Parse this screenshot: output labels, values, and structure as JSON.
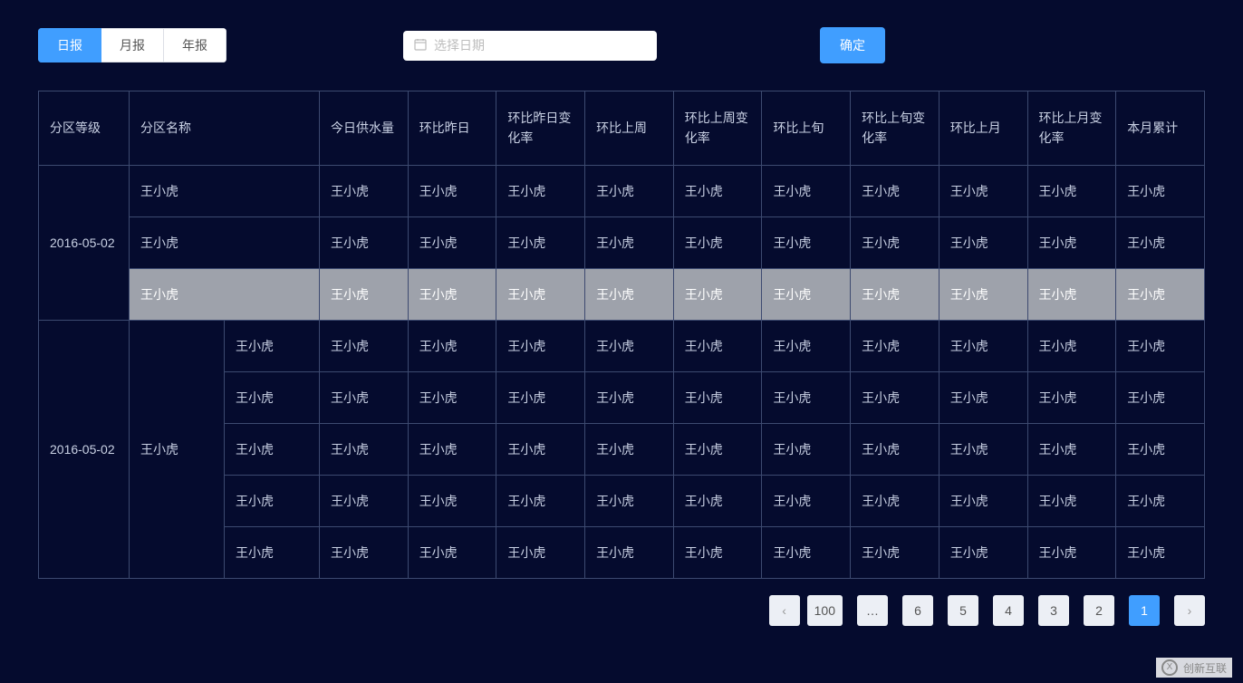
{
  "tabs": {
    "daily": "日报",
    "monthly": "月报",
    "yearly": "年报",
    "active": "daily"
  },
  "date_picker": {
    "placeholder": "选择日期"
  },
  "confirm_label": "确定",
  "table": {
    "headers": {
      "level": "分区等级",
      "name": "分区名称",
      "today_supply": "今日供水量",
      "vs_yesterday": "环比昨日",
      "vs_yesterday_rate": "环比昨日变化率",
      "vs_lastweek": "环比上周",
      "vs_lastweek_rate": "环比上周变化率",
      "vs_lastperiod": "环比上旬",
      "vs_lastperiod_rate": "环比上旬变化率",
      "vs_lastmonth": "环比上月",
      "vs_lastmonth_rate": "环比上月变化率",
      "month_total": "本月累计"
    },
    "groups": [
      {
        "level": "2016-05-02",
        "rows": [
          {
            "name": "王小虎",
            "cells": [
              "王小虎",
              "王小虎",
              "王小虎",
              "王小虎",
              "王小虎",
              "王小虎",
              "王小虎",
              "王小虎",
              "王小虎",
              "王小虎"
            ],
            "hover": false
          },
          {
            "name": "王小虎",
            "cells": [
              "王小虎",
              "王小虎",
              "王小虎",
              "王小虎",
              "王小虎",
              "王小虎",
              "王小虎",
              "王小虎",
              "王小虎",
              "王小虎"
            ],
            "hover": false
          },
          {
            "name": "王小虎",
            "cells": [
              "王小虎",
              "王小虎",
              "王小虎",
              "王小虎",
              "王小虎",
              "王小虎",
              "王小虎",
              "王小虎",
              "王小虎",
              "王小虎"
            ],
            "hover": true
          }
        ]
      },
      {
        "level": "2016-05-02",
        "sub_name": "王小虎",
        "rows": [
          {
            "cells": [
              "王小虎",
              "王小虎",
              "王小虎",
              "王小虎",
              "王小虎",
              "王小虎",
              "王小虎",
              "王小虎",
              "王小虎",
              "王小虎",
              "王小虎"
            ]
          },
          {
            "cells": [
              "王小虎",
              "王小虎",
              "王小虎",
              "王小虎",
              "王小虎",
              "王小虎",
              "王小虎",
              "王小虎",
              "王小虎",
              "王小虎",
              "王小虎"
            ]
          },
          {
            "cells": [
              "王小虎",
              "王小虎",
              "王小虎",
              "王小虎",
              "王小虎",
              "王小虎",
              "王小虎",
              "王小虎",
              "王小虎",
              "王小虎",
              "王小虎"
            ]
          },
          {
            "cells": [
              "王小虎",
              "王小虎",
              "王小虎",
              "王小虎",
              "王小虎",
              "王小虎",
              "王小虎",
              "王小虎",
              "王小虎",
              "王小虎",
              "王小虎"
            ]
          },
          {
            "cells": [
              "王小虎",
              "王小虎",
              "王小虎",
              "王小虎",
              "王小虎",
              "王小虎",
              "王小虎",
              "王小虎",
              "王小虎",
              "王小虎",
              "王小虎"
            ]
          }
        ]
      }
    ]
  },
  "pagination": {
    "prev": "‹",
    "pages": [
      "1",
      "2",
      "3",
      "4",
      "5",
      "6",
      "…",
      "100"
    ],
    "active_index": 0,
    "next": "›"
  },
  "watermark": "创新互联"
}
